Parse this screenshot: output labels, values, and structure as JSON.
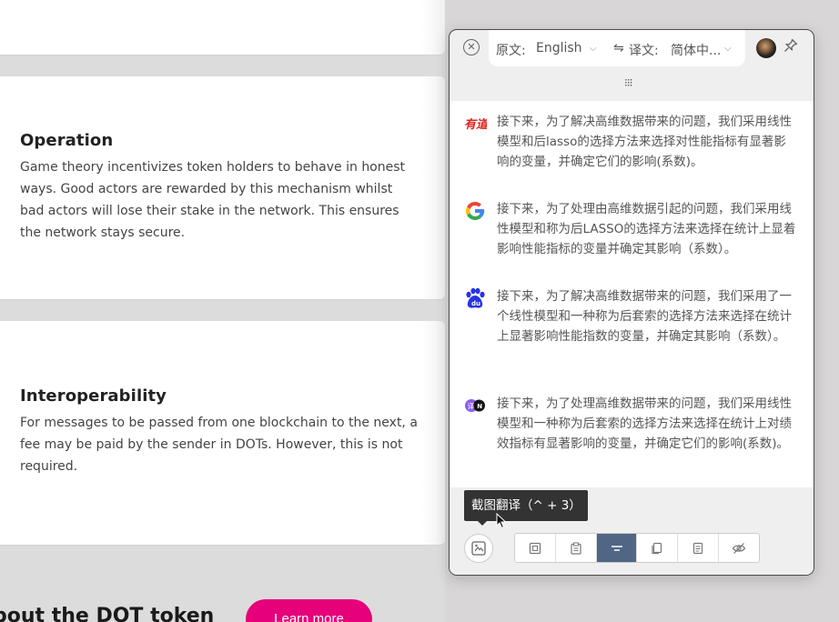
{
  "webpage": {
    "operation": {
      "title": "Operation",
      "text": "Game theory incentivizes token holders to behave in honest ways. Good actors are rewarded by this mechanism whilst bad actors will lose their stake in the network. This ensures the network stays secure."
    },
    "interoperability": {
      "title": "Interoperability",
      "text": "For messages to be passed from one blockchain to the next, a fee may be paid by the sender in DOTs. However, this is not required."
    },
    "bottom_heading": "bout the DOT token",
    "learn_more_button": "Learn more",
    "brand_color": "#e6007a"
  },
  "panel": {
    "source_label": "原文:",
    "source_lang": "English",
    "swap_icon": "⇋",
    "target_label": "译文:",
    "target_lang": "简体中...",
    "results": [
      {
        "engine": "youdao-icon",
        "text": "接下来，为了解决高维数据带来的问题，我们采用线性模型和后lasso的选择方法来选择对性能指标有显著影响的变量，并确定它们的影响(系数)。"
      },
      {
        "engine": "google-icon",
        "text": "接下来，为了处理由高维数据引起的问题，我们采用线性模型和称为后LASSO的选择方法来选择在统计上显着影响性能指标的变量并确定其影响（系数）。"
      },
      {
        "engine": "baidu-icon",
        "text": "接下来，为了解决高维数据带来的问题，我们采用了一个线性模型和一种称为后套索的选择方法来选择在统计上显著影响性能指数的变量，并确定其影响（系数）。"
      },
      {
        "engine": "openai-deepl-icon",
        "text": "接下来，为了处理高维数据带来的问题，我们采用线性模型和一种称为后套索的选择方法来选择在统计上对绩效指标有显著影响的变量，并确定它们的影响(系数)。"
      }
    ],
    "tooltip": "截图翻译（^ + 3）",
    "accent_color": "#4f6784"
  }
}
